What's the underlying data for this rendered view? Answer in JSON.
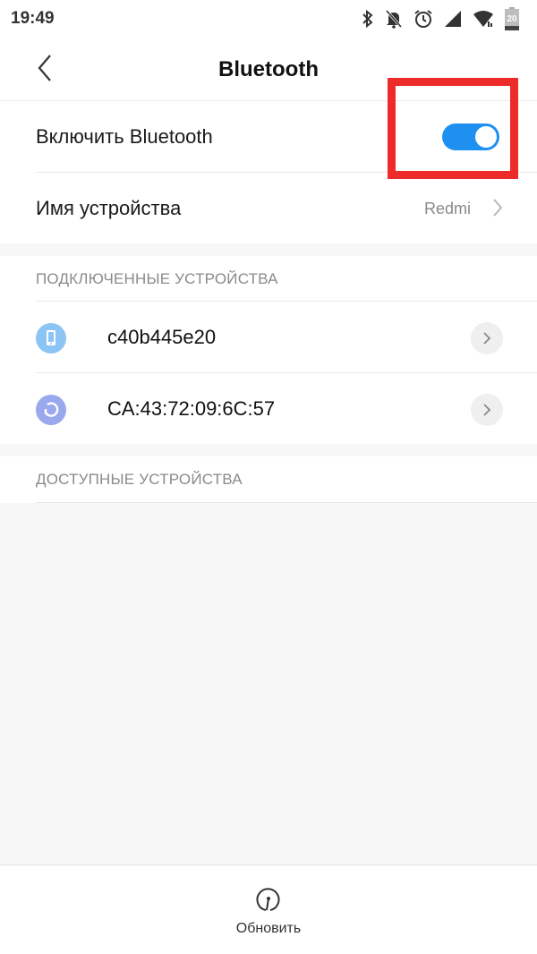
{
  "status_bar": {
    "time": "19:49",
    "icons": [
      "bluetooth-icon",
      "bell-off-icon",
      "alarm-icon",
      "signal-icon",
      "wifi-icon",
      "battery-icon"
    ],
    "battery_level": "20"
  },
  "header": {
    "back_icon": "chevron-left-icon",
    "title": "Bluetooth"
  },
  "settings": {
    "enable_bluetooth": {
      "label": "Включить Bluetooth",
      "enabled": true
    },
    "device_name": {
      "label": "Имя устройства",
      "value": "Redmi"
    }
  },
  "connected_devices": {
    "header": "ПОДКЛЮЧЕННЫЕ УСТРОЙСТВА",
    "items": [
      {
        "name": "c40b445e20",
        "icon": "phone-icon",
        "icon_color": "#8cc4f5"
      },
      {
        "name": "CA:43:72:09:6C:57",
        "icon": "sync-icon",
        "icon_color": "#9aa8ee"
      }
    ]
  },
  "available_devices": {
    "header": "ДОСТУПНЫЕ УСТРОЙСТВА",
    "items": []
  },
  "bottom_bar": {
    "refresh_label": "Обновить",
    "refresh_icon": "refresh-icon"
  },
  "colors": {
    "accent": "#1e90f0",
    "highlight": "#ee2b2b"
  }
}
